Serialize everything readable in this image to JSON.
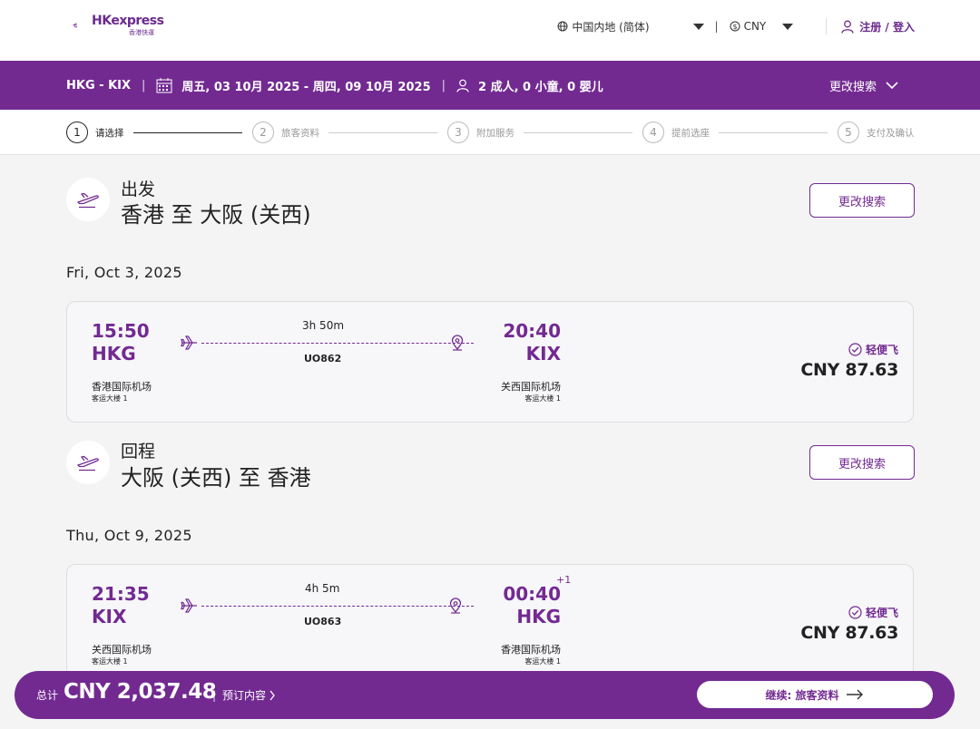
{
  "header": {
    "logo_text": "HKexpress",
    "logo_sub": "香港快運",
    "region": "中国内地 (简体)",
    "currency": "CNY",
    "login": "注册 / 登入"
  },
  "search": {
    "route": "HKG - KIX",
    "dates": "周五, 03 10月 2025 - 周四, 09 10月 2025",
    "passengers": "2 成人, 0 小童, 0 婴儿",
    "modify": "更改搜索"
  },
  "steps": [
    {
      "num": "1",
      "label": "请选择"
    },
    {
      "num": "2",
      "label": "旅客资料"
    },
    {
      "num": "3",
      "label": "附加服务"
    },
    {
      "num": "4",
      "label": "提前选座"
    },
    {
      "num": "5",
      "label": "支付及确认"
    }
  ],
  "outbound": {
    "label": "出发",
    "route": "香港 至 大阪 (关西)",
    "modify": "更改搜索",
    "date": "Fri, Oct 3, 2025",
    "dep_time": "15:50",
    "dep_code": "HKG",
    "dep_airport": "香港国际机场",
    "dep_terminal": "客运大楼 1",
    "duration": "3h 50m",
    "flight_no": "UO862",
    "arr_time": "20:40",
    "arr_code": "KIX",
    "arr_airport": "关西国际机场",
    "arr_terminal": "客运大楼 1",
    "fare_type": "轻便飞",
    "price": "CNY 87.63"
  },
  "inbound": {
    "label": "回程",
    "route": "大阪 (关西) 至 香港",
    "modify": "更改搜索",
    "date": "Thu, Oct 9, 2025",
    "dep_time": "21:35",
    "dep_code": "KIX",
    "dep_airport": "关西国际机场",
    "dep_terminal": "客运大楼 1",
    "duration": "4h 5m",
    "flight_no": "UO863",
    "arr_time": "00:40",
    "arr_plus": "+1",
    "arr_code": "HKG",
    "arr_airport": "香港国际机场",
    "arr_terminal": "客运大楼 1",
    "fare_type": "轻便飞",
    "price": "CNY 87.63"
  },
  "footer": {
    "total_label": "总计",
    "total_value": "CNY 2,037.48",
    "booking_label": "预订内容",
    "continue": "继续: 旅客资料"
  },
  "colors": {
    "brand": "#722a91",
    "background": "#f4f4f5"
  }
}
